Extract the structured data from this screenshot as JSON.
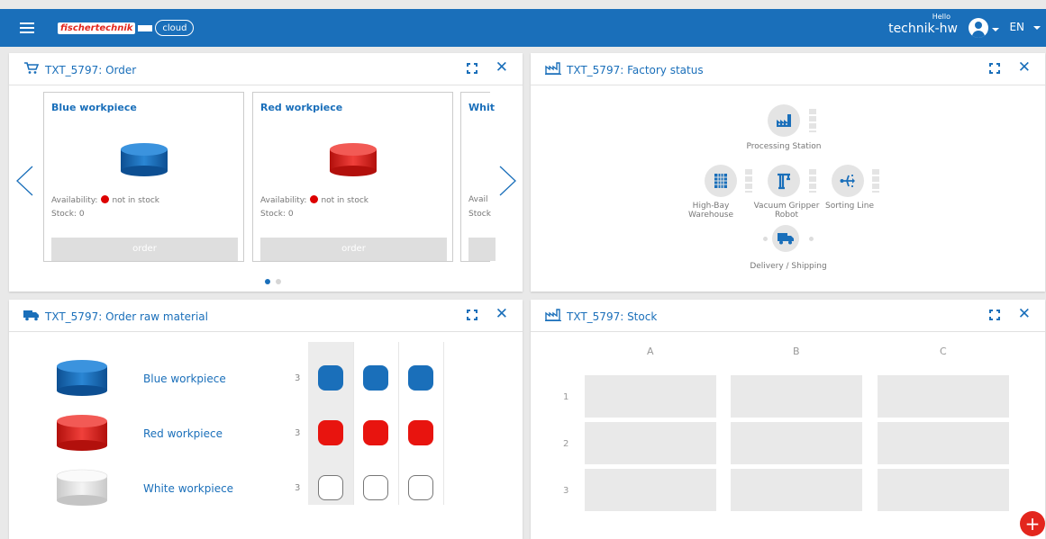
{
  "header": {
    "brand_text": "fischertechnik",
    "cloud_text": "cloud",
    "hello": "Hello",
    "username": "technik-hw",
    "language": "EN",
    "colors": {
      "topbar": "#1a6fba",
      "brand_red": "#e3261d"
    }
  },
  "order_panel": {
    "title": "TXT_5797: Order",
    "cards": [
      {
        "title": "Blue workpiece",
        "availability_label": "Availability:",
        "availability_value": "not in stock",
        "stock_label": "Stock:",
        "stock_value": "0",
        "button": "order",
        "color": "#1a6fba"
      },
      {
        "title": "Red workpiece",
        "availability_label": "Availability:",
        "availability_value": "not in stock",
        "stock_label": "Stock:",
        "stock_value": "0",
        "button": "order",
        "color": "#e3261d"
      },
      {
        "title": "Whit",
        "availability_label": "Avail",
        "stock_label": "Stock"
      }
    ],
    "page_count": 2,
    "current_page": 1
  },
  "factory_panel": {
    "title": "TXT_5797: Factory status",
    "stations": {
      "processing": "Processing Station",
      "warehouse": "High-Bay Warehouse",
      "vgr": "Vacuum Gripper Robot",
      "sorting": "Sorting Line",
      "delivery": "Delivery / Shipping"
    },
    "icons": [
      "factory-icon",
      "warehouse-icon",
      "crane-icon",
      "sorting-icon",
      "truck-icon"
    ]
  },
  "raw_panel": {
    "title": "TXT_5797: Order raw material",
    "rows": [
      {
        "name": "Blue workpiece",
        "count": "3",
        "color": "#1a6fba",
        "filled": true
      },
      {
        "name": "Red workpiece",
        "count": "3",
        "color": "#e8140f",
        "filled": true
      },
      {
        "name": "White workpiece",
        "count": "3",
        "color": "#ffffff",
        "filled": false
      }
    ]
  },
  "stock_panel": {
    "title": "TXT_5797: Stock",
    "columns": [
      "A",
      "B",
      "C"
    ],
    "rows": [
      "1",
      "2",
      "3"
    ]
  },
  "fab_label": "+"
}
